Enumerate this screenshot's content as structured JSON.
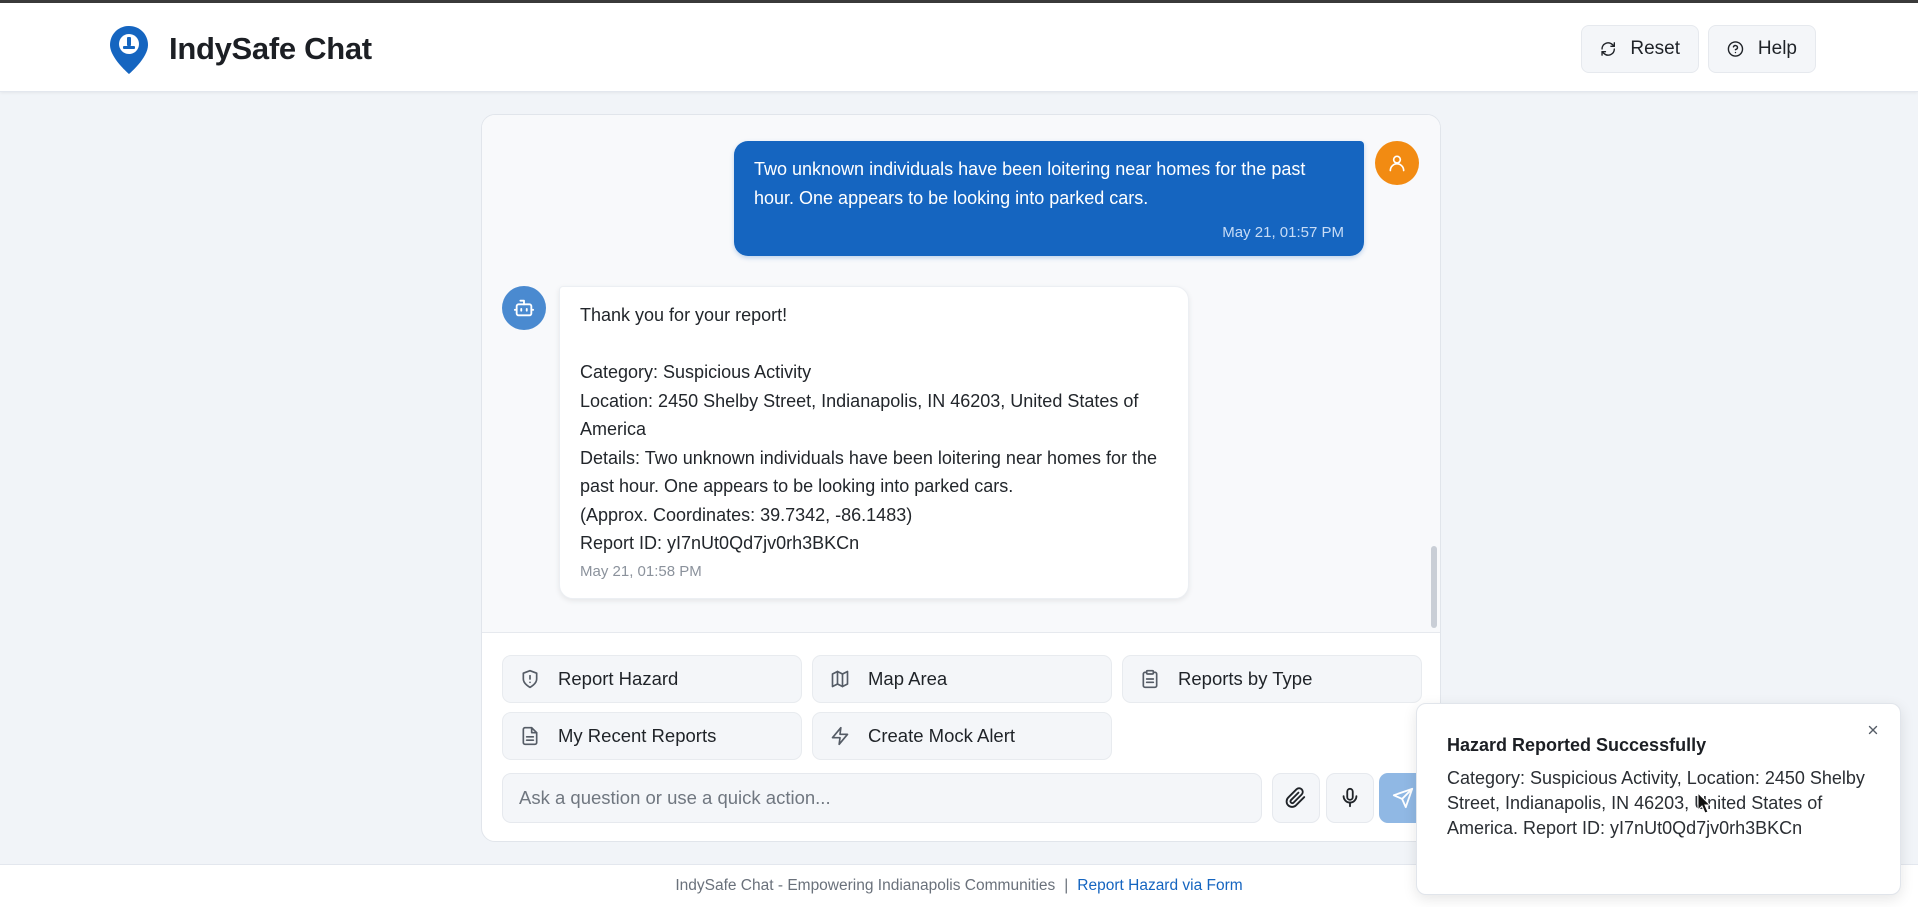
{
  "header": {
    "title": "IndySafe Chat",
    "reset_label": "Reset",
    "help_label": "Help"
  },
  "colors": {
    "brand": "#1565c0",
    "user_avatar": "#f28b12",
    "bot_avatar": "#4a8ad0"
  },
  "messages": [
    {
      "role": "user",
      "text": "Two unknown individuals have been loitering near homes for the past hour. One appears to be looking into parked cars.",
      "time": "May 21, 01:57 PM"
    },
    {
      "role": "bot",
      "lines": [
        "Thank you for your report!",
        "",
        "Category: Suspicious Activity",
        "Location: 2450 Shelby Street, Indianapolis, IN 46203, United States of America",
        "Details: Two unknown individuals have been loitering near homes for the past hour. One appears to be looking into parked cars.",
        "(Approx. Coordinates: 39.7342, -86.1483)",
        "Report ID: yI7nUt0Qd7jv0rh3BKCn"
      ],
      "time": "May 21, 01:58 PM"
    }
  ],
  "quick_actions": [
    {
      "label": "Report Hazard",
      "icon": "shield-icon"
    },
    {
      "label": "Map Area",
      "icon": "map-icon"
    },
    {
      "label": "Reports by Type",
      "icon": "clipboard-icon"
    },
    {
      "label": "My Recent Reports",
      "icon": "file-text-icon"
    },
    {
      "label": "Create Mock Alert",
      "icon": "zap-icon"
    }
  ],
  "input": {
    "placeholder": "Ask a question or use a quick action...",
    "value": ""
  },
  "footer": {
    "text": "IndySafe Chat - Empowering Indianapolis Communities",
    "link_label": "Report Hazard via Form"
  },
  "toast": {
    "title": "Hazard Reported Successfully",
    "body": "Category: Suspicious Activity, Location: 2450 Shelby Street, Indianapolis, IN 46203, United States of America. Report ID: yI7nUt0Qd7jv0rh3BKCn"
  }
}
